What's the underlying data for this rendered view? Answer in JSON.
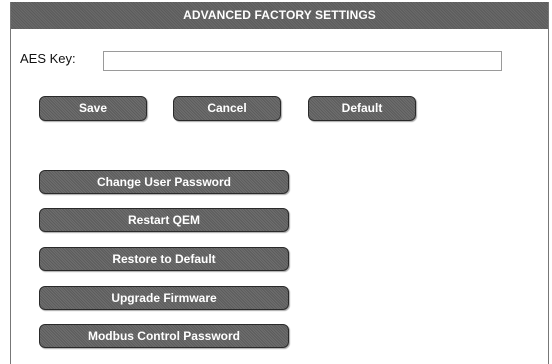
{
  "panel": {
    "title": "ADVANCED FACTORY SETTINGS"
  },
  "aes": {
    "label": "AES Key:",
    "value": "",
    "placeholder": ""
  },
  "actions": {
    "save": "Save",
    "cancel": "Cancel",
    "default": "Default"
  },
  "tools": [
    "Change User Password",
    "Restart QEM",
    "Restore to Default",
    "Upgrade Firmware",
    "Modbus Control Password"
  ],
  "colors": {
    "button_bg": "#626262",
    "header_bg": "#636363",
    "text_light": "#ffffff"
  }
}
